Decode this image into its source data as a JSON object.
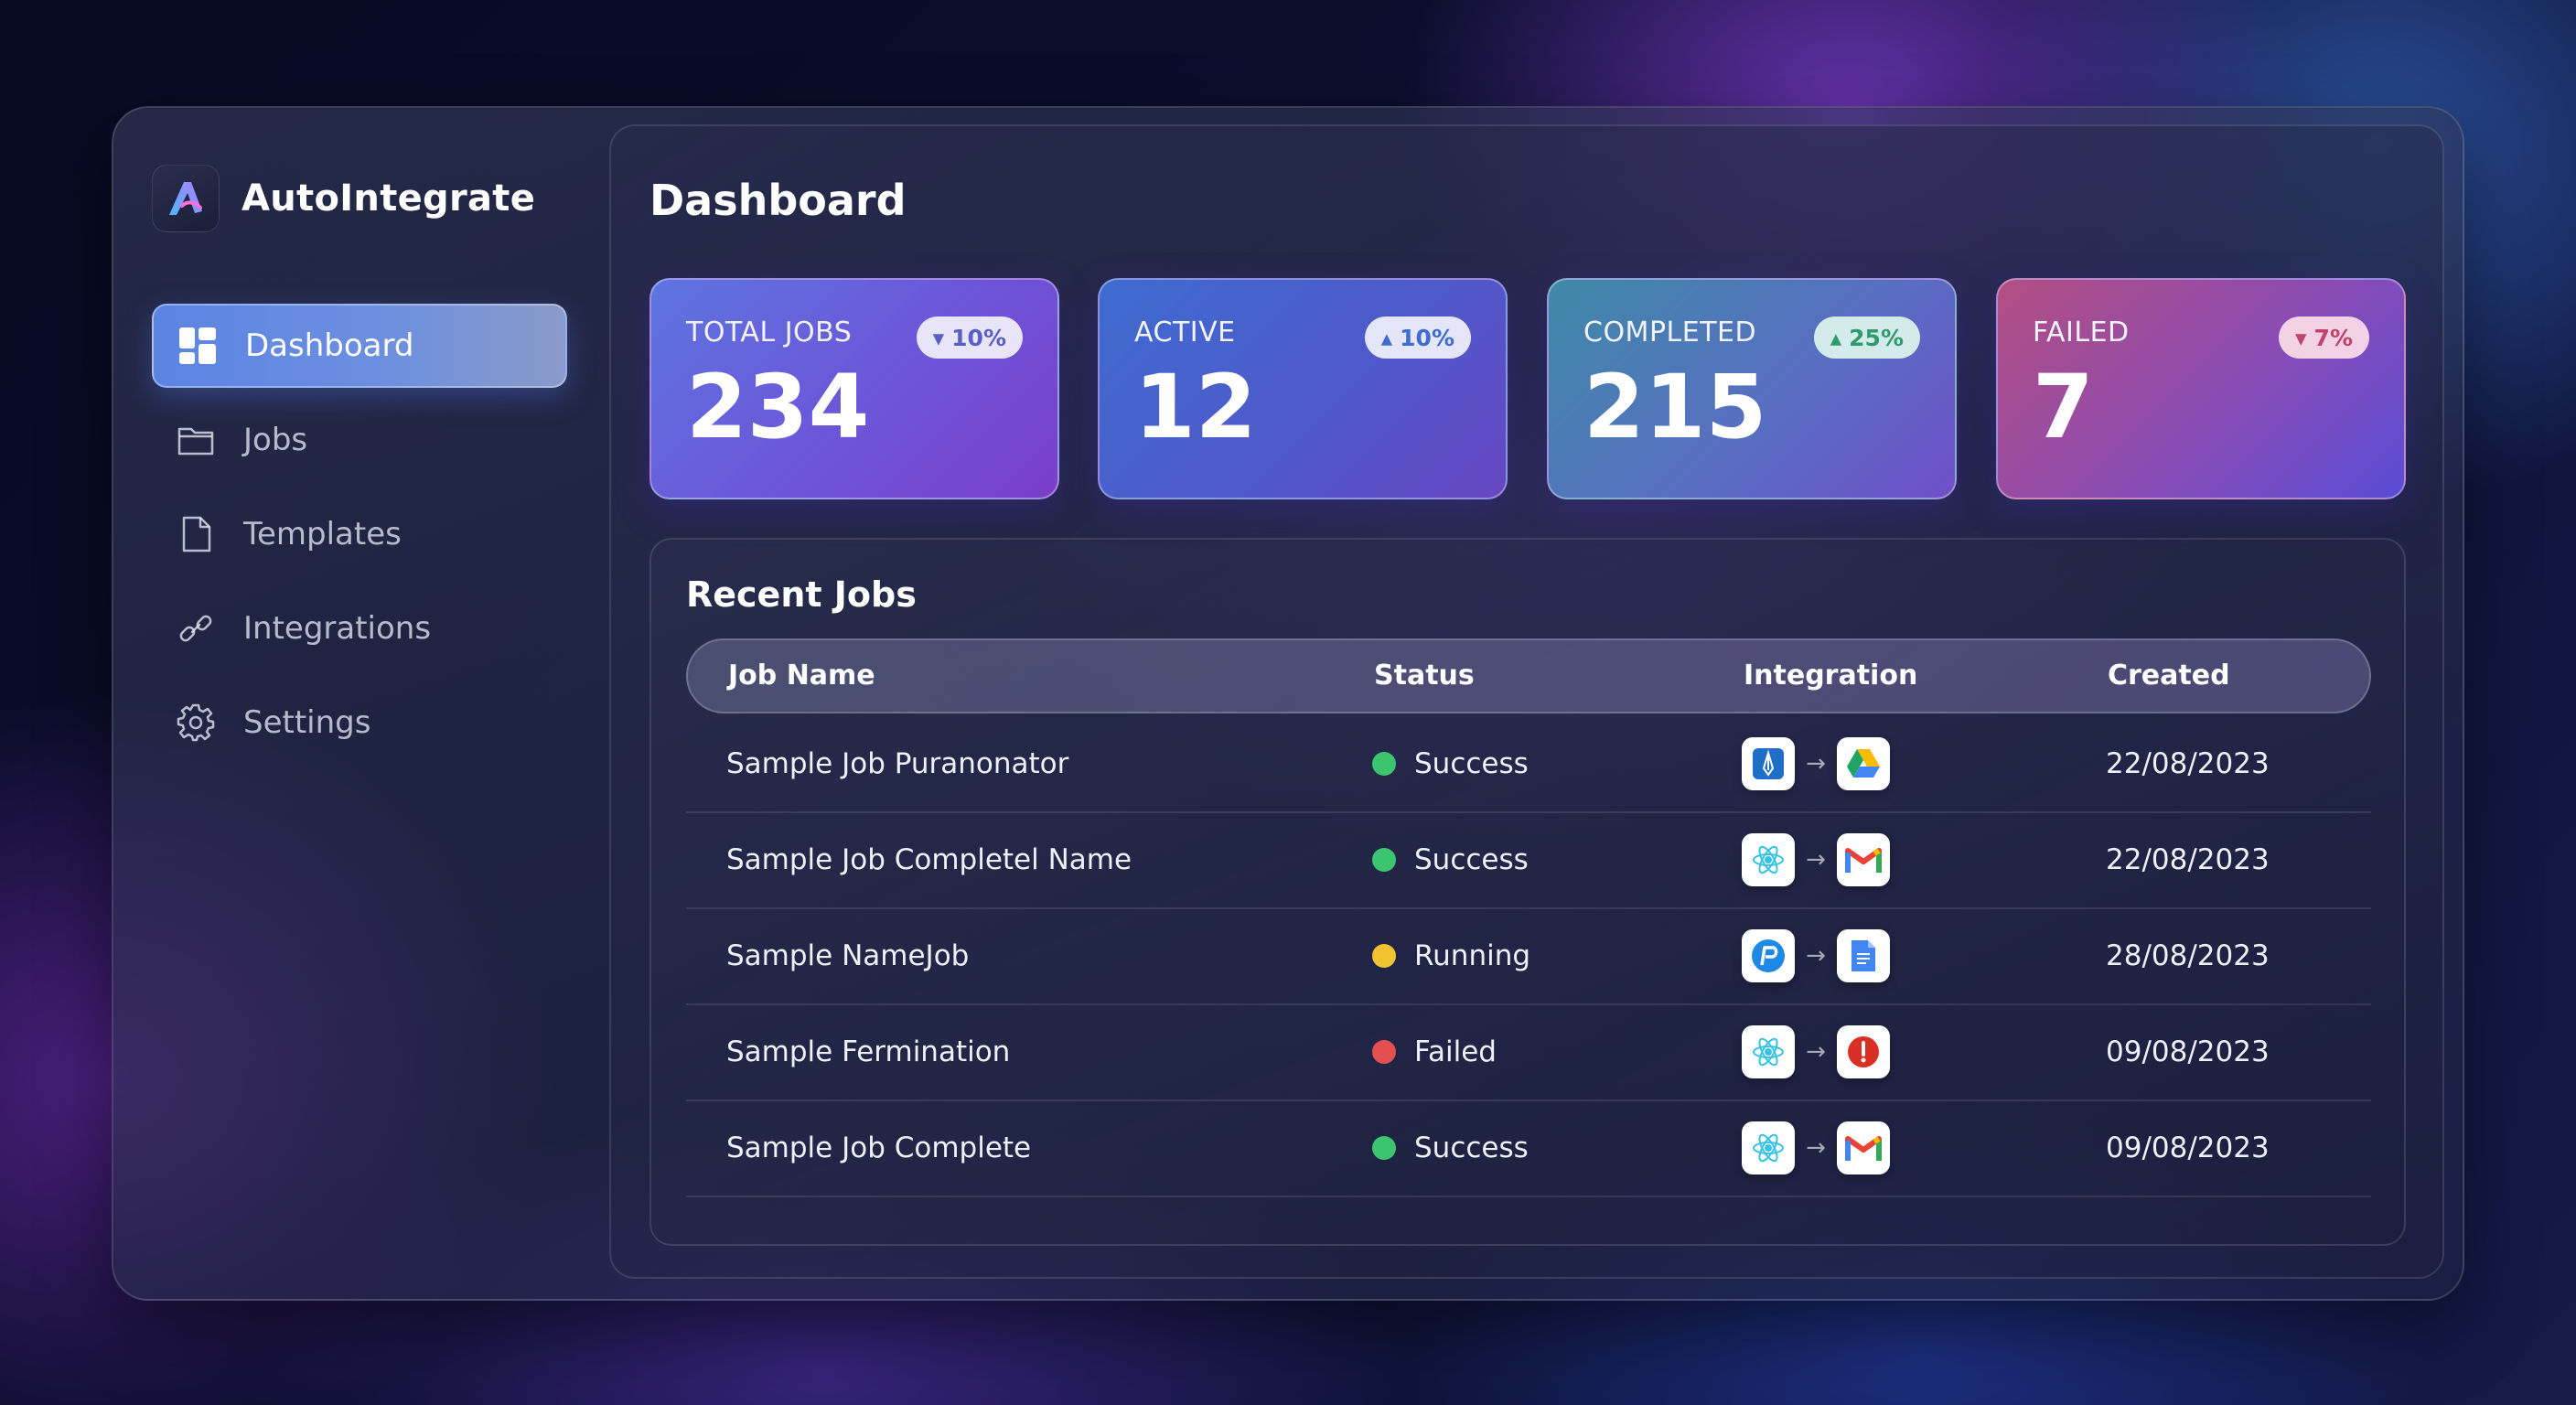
{
  "app": {
    "name": "AutoIntegrate"
  },
  "sidebar": {
    "items": [
      {
        "label": "Dashboard",
        "icon": "dashboard-grid-icon",
        "active": true
      },
      {
        "label": "Jobs",
        "icon": "folder-icon",
        "active": false
      },
      {
        "label": "Templates",
        "icon": "document-icon",
        "active": false
      },
      {
        "label": "Integrations",
        "icon": "link-icon",
        "active": false
      },
      {
        "label": "Settings",
        "icon": "gear-icon",
        "active": false
      }
    ]
  },
  "page": {
    "title": "Dashboard"
  },
  "stats": [
    {
      "label": "TOTAL JOBS",
      "value": "234",
      "change": "10%",
      "trend": "down"
    },
    {
      "label": "ACTIVE",
      "value": "12",
      "change": "10%",
      "trend": "up"
    },
    {
      "label": "COMPLETED",
      "value": "215",
      "change": "25%",
      "trend": "up"
    },
    {
      "label": "FAILED",
      "value": "7",
      "change": "7%",
      "trend": "down"
    }
  ],
  "recent_jobs": {
    "title": "Recent Jobs",
    "columns": [
      "Job Name",
      "Status",
      "Integration",
      "Created"
    ],
    "rows": [
      {
        "name": "Sample Job Puranonator",
        "status": "Success",
        "status_color": "#3cc46e",
        "from": "pen-tool-icon",
        "to": "google-drive-icon",
        "created": "22/08/2023"
      },
      {
        "name": "Sample Job Completel Name",
        "status": "Success",
        "status_color": "#3cc46e",
        "from": "react-atom-icon",
        "to": "gmail-icon",
        "created": "22/08/2023"
      },
      {
        "name": "Sample NameJob",
        "status": "Running",
        "status_color": "#f1c232",
        "from": "paypal-p-icon",
        "to": "google-docs-icon",
        "created": "28/08/2023"
      },
      {
        "name": "Sample Fermination",
        "status": "Failed",
        "status_color": "#e45050",
        "from": "react-atom-icon",
        "to": "error-alert-icon",
        "created": "09/08/2023"
      },
      {
        "name": "Sample Job Complete",
        "status": "Success",
        "status_color": "#3cc46e",
        "from": "react-atom-icon",
        "to": "gmail-icon",
        "created": "09/08/2023"
      }
    ]
  },
  "colors": {
    "accent": "#5b84e3",
    "success": "#3cc46e",
    "running": "#f1c232",
    "failed": "#e45050"
  }
}
